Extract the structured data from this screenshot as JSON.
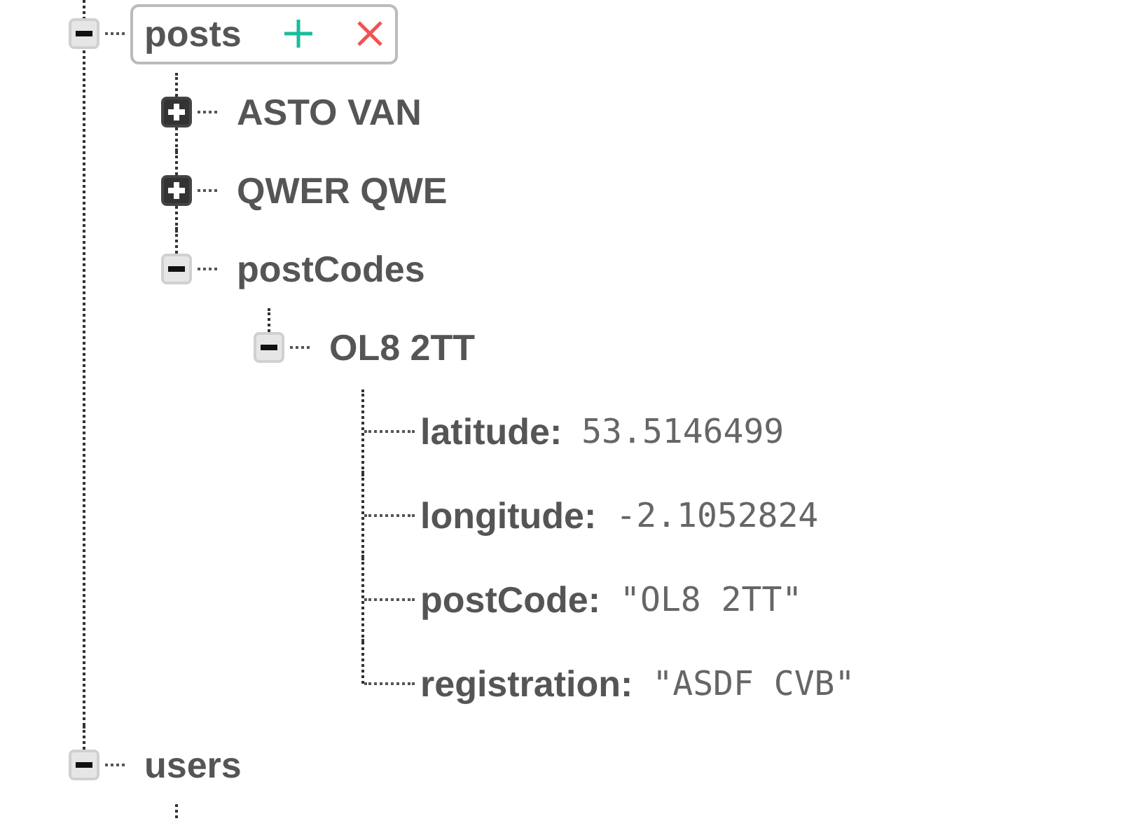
{
  "tree": [
    {
      "name": "posts",
      "expanded": true,
      "selected": true,
      "children": [
        {
          "name": "ASTO VAN",
          "expanded": false,
          "selected": false
        },
        {
          "name": "QWER QWE",
          "expanded": false,
          "selected": false
        },
        {
          "name": "postCodes",
          "expanded": true,
          "selected": false,
          "children": [
            {
              "name": "OL8 2TT",
              "expanded": true,
              "selected": false,
              "children": [
                {
                  "kind": "leaf",
                  "key": "latitude:",
                  "value": "53.5146499",
                  "selected": false
                },
                {
                  "kind": "leaf",
                  "key": "longitude:",
                  "value": "-2.1052824",
                  "selected": false
                },
                {
                  "kind": "leaf",
                  "key": "postCode:",
                  "value": "\"OL8 2TT\"",
                  "selected": false
                },
                {
                  "kind": "leaf",
                  "key": "registration:",
                  "value": "\"ASDF CVB\"",
                  "selected": false
                }
              ]
            }
          ]
        }
      ]
    },
    {
      "name": "users",
      "expanded": true,
      "selected": false
    }
  ]
}
